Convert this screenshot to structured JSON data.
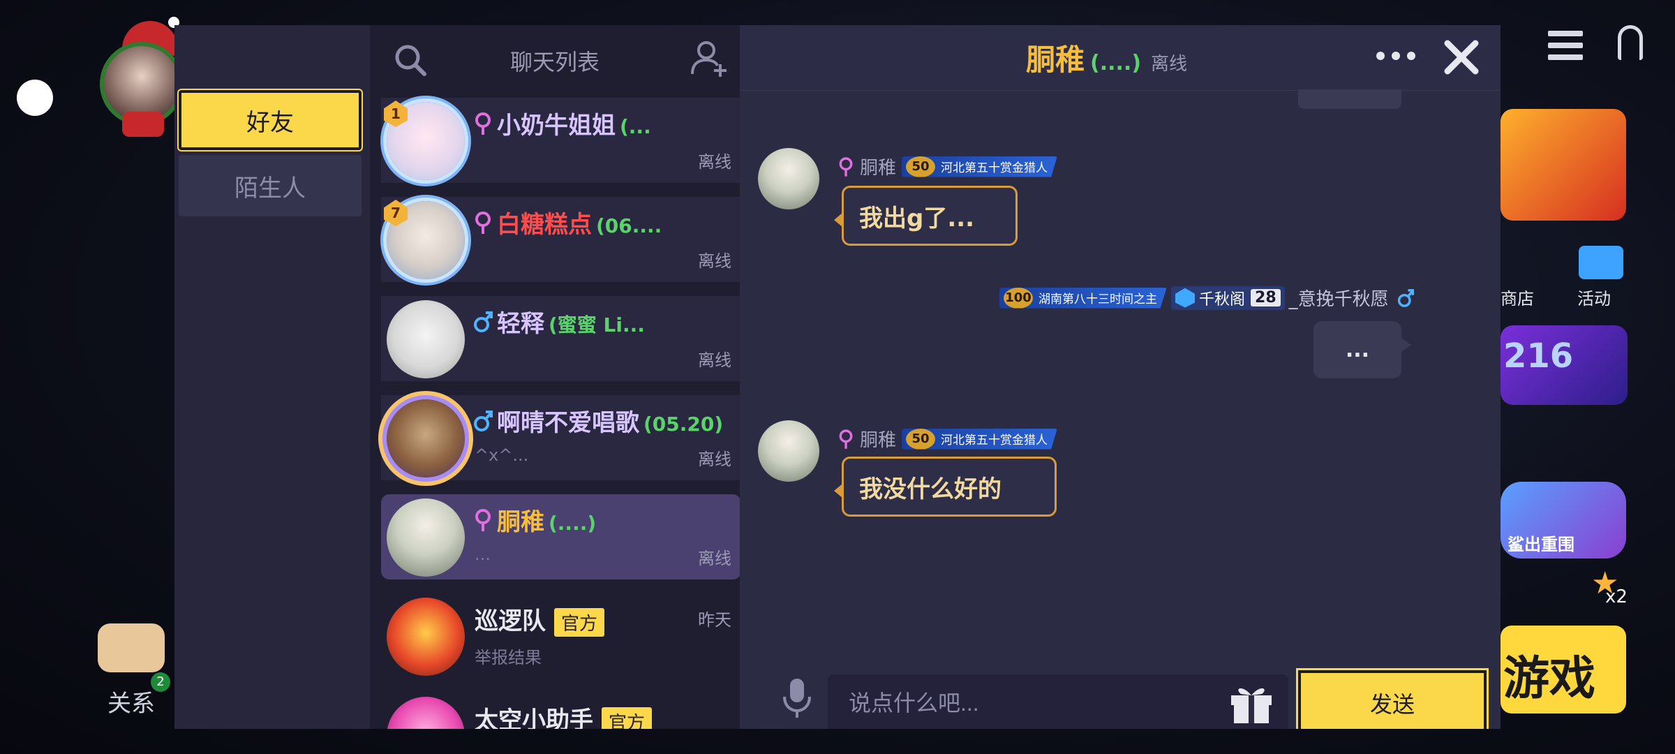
{
  "background": {
    "relation_label": "关系",
    "relation_badge": "2",
    "shop_label": "商店",
    "activity_label": "活动",
    "card2_text": "216",
    "card3_text": "鲨出重围",
    "star_count": "x2",
    "game_text": "游戏"
  },
  "tabs": {
    "friends": "好友",
    "strangers": "陌生人"
  },
  "list": {
    "title": "聊天列表",
    "contacts": [
      {
        "rank": "1",
        "name": "小奶牛姐姐",
        "remark": "(...",
        "status": "离线",
        "preview": "",
        "name_color": "#d8c4ff",
        "gender": "female"
      },
      {
        "rank": "7",
        "name": "白糖糕点",
        "remark": "(06....",
        "status": "离线",
        "preview": "",
        "name_color": "#ff4c4c",
        "gender": "female"
      },
      {
        "rank": "",
        "name": "轻释",
        "remark": "(蜜蜜 Li...",
        "status": "离线",
        "preview": "",
        "name_color": "#d8c4ff",
        "gender": "male"
      },
      {
        "rank": "",
        "name": "啊晴不爱唱歌",
        "remark": "(05.20)",
        "status": "离线",
        "preview": "^x^...",
        "name_color": "#d8c4ff",
        "gender": "male"
      },
      {
        "rank": "",
        "name": "胴稚",
        "remark": "(....)",
        "status": "离线",
        "preview": "...",
        "name_color": "#f7bd3d",
        "gender": "female"
      },
      {
        "name": "巡逻队",
        "official": "官方",
        "status": "昨天",
        "preview": "举报结果",
        "name_color": "#e8e8f0"
      },
      {
        "name": "太空小助手",
        "official": "官方",
        "status": "",
        "preview": "",
        "name_color": "#e8e8f0"
      }
    ]
  },
  "chat": {
    "name": "胴稚",
    "remark": "(....)",
    "status": "离线",
    "messages": [
      {
        "sender": "胴稚",
        "badge_level": "50",
        "badge_text": "河北第五十赏金猎人",
        "text": "我出g了..."
      },
      {
        "sender": "_意挽千秋愿",
        "badge_level": "100",
        "badge_text": "湖南第八十三时间之主",
        "guild": "千秋阁",
        "guild_level": "28",
        "text": "..."
      },
      {
        "sender": "胴稚",
        "badge_level": "50",
        "badge_text": "河北第五十赏金猎人",
        "text": "我没什么好的"
      }
    ],
    "input_placeholder": "说点什么吧...",
    "send_label": "发送"
  },
  "colors": {
    "accent_yellow": "#fbd84a",
    "online_green": "#59d36a",
    "bubble_border": "#d99c38",
    "female_pink": "#e070e0",
    "male_blue": "#4fb4ff"
  }
}
